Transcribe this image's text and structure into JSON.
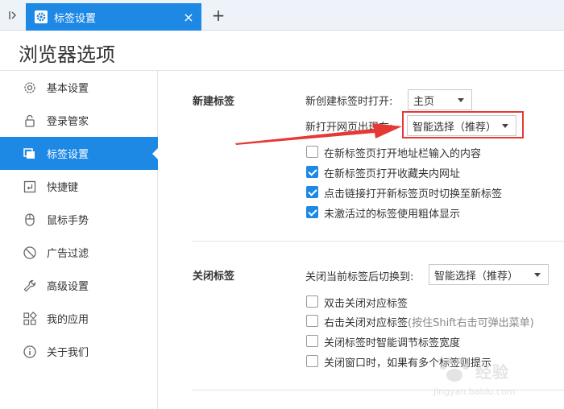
{
  "tabbar": {
    "tab_title": "标签设置",
    "close_label": "×",
    "new_tab_label": "+"
  },
  "page": {
    "title": "浏览器选项"
  },
  "sidebar": {
    "items": [
      {
        "label": "基本设置",
        "icon": "gear-icon"
      },
      {
        "label": "登录管家",
        "icon": "lock-icon"
      },
      {
        "label": "标签设置",
        "icon": "tabs-icon",
        "active": true
      },
      {
        "label": "快捷键",
        "icon": "keyboard-icon"
      },
      {
        "label": "鼠标手势",
        "icon": "mouse-icon"
      },
      {
        "label": "广告过滤",
        "icon": "block-icon"
      },
      {
        "label": "高级设置",
        "icon": "wrench-icon"
      },
      {
        "label": "我的应用",
        "icon": "apps-icon"
      },
      {
        "label": "关于我们",
        "icon": "info-icon"
      }
    ],
    "accent_color": "#1e88e5"
  },
  "new_tab": {
    "title": "新建标签",
    "open_label": "新创建标签时打开:",
    "open_value": "主页",
    "position_label": "新打开网页出现在:",
    "position_value": "智能选择（推荐）",
    "options": [
      {
        "label": "在新标签页打开地址栏输入的内容",
        "checked": false
      },
      {
        "label": "在新标签页打开收藏夹内网址",
        "checked": true
      },
      {
        "label": "点击链接打开新标签页时切换至新标签",
        "checked": true
      },
      {
        "label": "未激活过的标签使用粗体显示",
        "checked": true
      }
    ]
  },
  "close_tab": {
    "title": "关闭标签",
    "switch_label": "关闭当前标签后切换到:",
    "switch_value": "智能选择（推荐）",
    "options": [
      {
        "label": "双击关闭对应标签",
        "checked": false
      },
      {
        "label": "右击关闭对应标签",
        "hint": "(按住Shift右击可弹出菜单)",
        "checked": false
      },
      {
        "label": "关闭标签时智能调节标签宽度",
        "checked": false
      },
      {
        "label": "关闭窗口时，如果有多个标签则提示",
        "checked": false
      }
    ]
  },
  "watermark": {
    "text": "经验",
    "url": "jingyan.baidu.com"
  }
}
